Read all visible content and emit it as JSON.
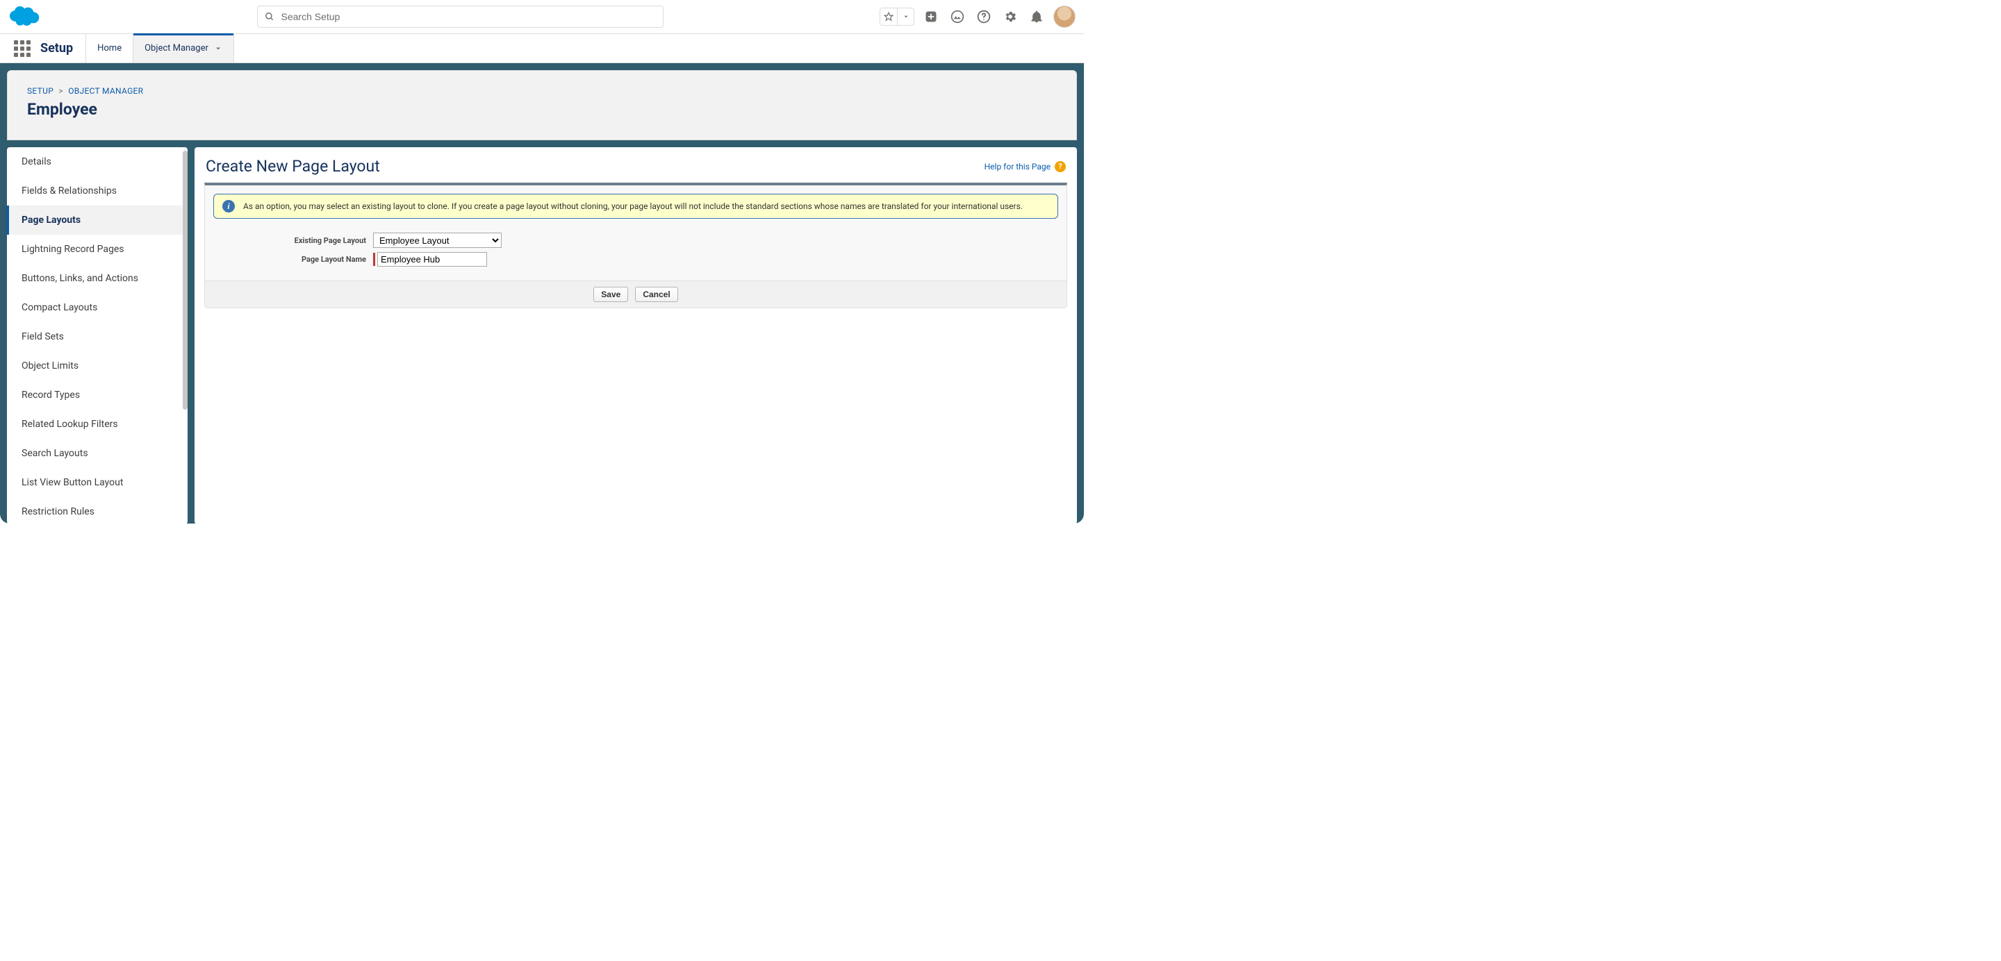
{
  "header": {
    "search_placeholder": "Search Setup",
    "app_name": "Setup",
    "tabs": [
      {
        "label": "Home",
        "active": false,
        "dropdown": false
      },
      {
        "label": "Object Manager",
        "active": true,
        "dropdown": true
      }
    ]
  },
  "breadcrumb": {
    "setup": "SETUP",
    "object_manager": "OBJECT MANAGER"
  },
  "object_title": "Employee",
  "sidebar": {
    "items": [
      "Details",
      "Fields & Relationships",
      "Page Layouts",
      "Lightning Record Pages",
      "Buttons, Links, and Actions",
      "Compact Layouts",
      "Field Sets",
      "Object Limits",
      "Record Types",
      "Related Lookup Filters",
      "Search Layouts",
      "List View Button Layout",
      "Restriction Rules"
    ],
    "active_index": 2
  },
  "main": {
    "title": "Create New Page Layout",
    "help_link": "Help for this Page",
    "info_banner": "As an option, you may select an existing layout to clone. If you create a page layout without cloning, your page layout will not include the standard sections whose names are translated for your international users.",
    "form": {
      "existing_layout": {
        "label": "Existing Page Layout",
        "value": "Employee Layout"
      },
      "layout_name": {
        "label": "Page Layout Name",
        "value": "Employee Hub"
      }
    },
    "buttons": {
      "save": "Save",
      "cancel": "Cancel"
    }
  }
}
